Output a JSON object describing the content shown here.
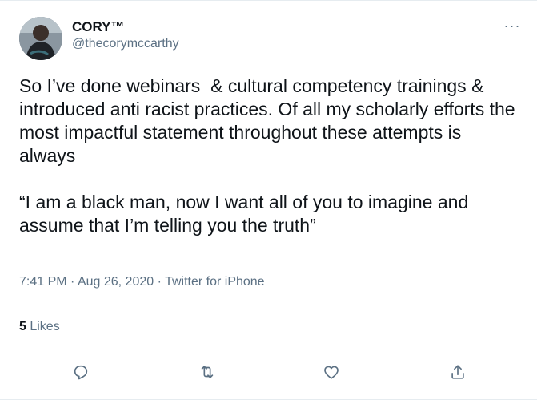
{
  "author": {
    "display_name": "CORY™",
    "handle": "@thecorymccarthy"
  },
  "menu": {
    "more_label": "···"
  },
  "tweet": {
    "text": "So I’ve done webinars  & cultural competency trainings & introduced anti racist practices. Of all my scholarly efforts the most impactful statement throughout these attempts is always\n\n“I am a black man, now I want all of you to imagine and assume that I’m telling you the truth”",
    "time": "7:41 PM",
    "separator1": " · ",
    "date": "Aug 26, 2020",
    "separator2": " · ",
    "source": "Twitter for iPhone"
  },
  "stats": {
    "likes_count": "5",
    "likes_label": " Likes"
  },
  "actions": {
    "reply_icon": "reply-icon",
    "retweet_icon": "retweet-icon",
    "like_icon": "like-icon",
    "share_icon": "share-icon"
  },
  "colors": {
    "text": "#0f1419",
    "secondary": "#5b7083",
    "divider": "#e6ecf0"
  }
}
